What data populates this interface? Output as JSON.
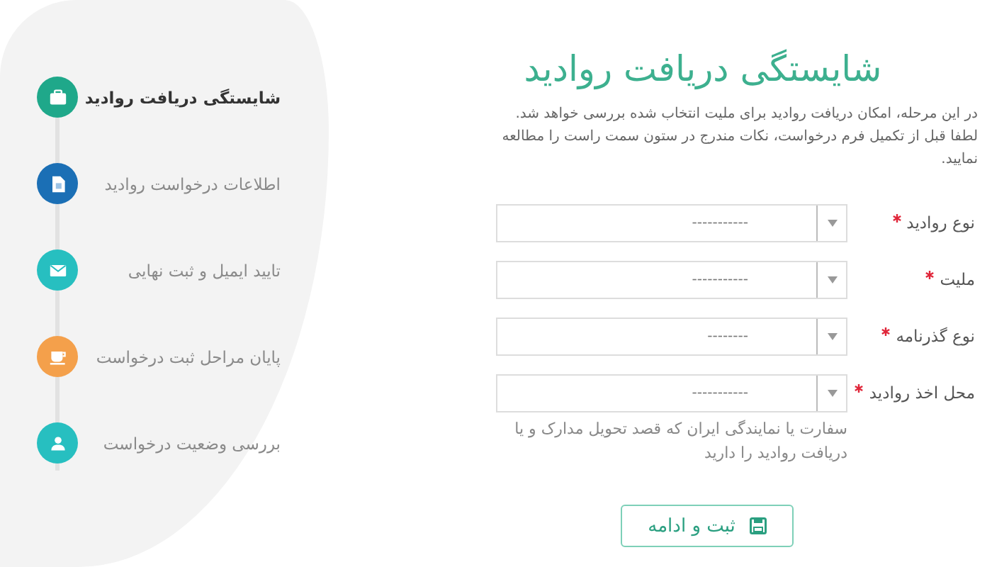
{
  "sidebar": {
    "steps": [
      {
        "label": "شایستگی دریافت روادید",
        "selected": true,
        "color": "#1fa88a"
      },
      {
        "label": "اطلاعات درخواست روادید",
        "selected": false,
        "color": "#1b6fb5"
      },
      {
        "label": "تایید ایمیل و ثبت نهایی",
        "selected": false,
        "color": "#27bfc0"
      },
      {
        "label": "پایان مراحل ثبت درخواست",
        "selected": false,
        "color": "#f4a04b"
      },
      {
        "label": "بررسی وضعیت درخواست",
        "selected": false,
        "color": "#27bfc0"
      }
    ]
  },
  "main": {
    "title": "شایستگی دریافت روادید",
    "description": "در این مرحله، امکان دریافت روادید برای ملیت انتخاب شده بررسی خواهد شد. لطفا قبل از تکمیل فرم درخواست، نکات مندرج در ستون سمت راست را مطالعه نمایید.",
    "fields": [
      {
        "label": "نوع روادید",
        "required": true,
        "value": "-----------"
      },
      {
        "label": "ملیت",
        "required": true,
        "value": "-----------"
      },
      {
        "label": "نوع گذرنامه",
        "required": true,
        "value": "--------"
      },
      {
        "label": "محل اخذ روادید",
        "required": true,
        "value": "-----------",
        "help": "سفارت یا نمایندگی ایران که قصد تحویل مدارک و یا دریافت روادید را دارید"
      }
    ],
    "button": {
      "label": "ثبت و ادامه"
    }
  }
}
